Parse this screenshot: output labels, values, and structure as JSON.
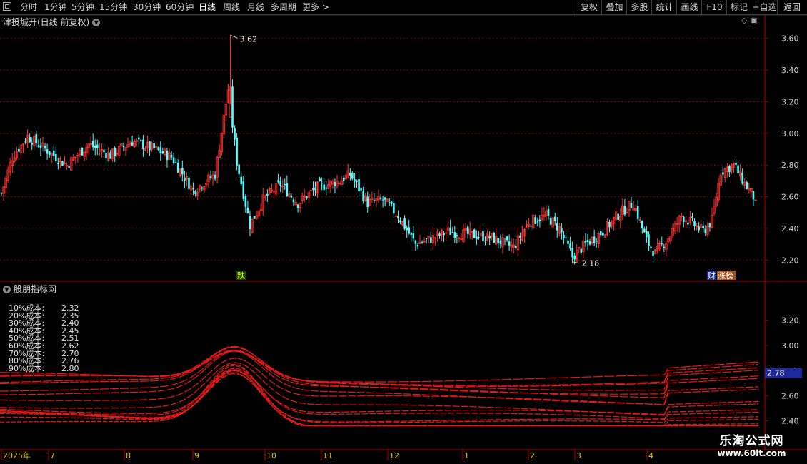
{
  "toolbar": {
    "periods": [
      "分时",
      "1分钟",
      "5分钟",
      "15分钟",
      "30分钟",
      "60分钟",
      "日线",
      "周线",
      "月线",
      "多周期",
      "更多"
    ],
    "active_period": "日线",
    "more_arrow": ">",
    "right_buttons": [
      "复权",
      "叠加",
      "多股",
      "统计",
      "画线",
      "F10",
      "标记",
      "+自选",
      "返回"
    ]
  },
  "stock_title": "津投城开(日线 前复权)",
  "indicator_title": "股朋指标网",
  "cost_table": [
    {
      "label": "10%成本:",
      "value": "2.32"
    },
    {
      "label": "20%成本:",
      "value": "2.35"
    },
    {
      "label": "30%成本:",
      "value": "2.40"
    },
    {
      "label": "40%成本:",
      "value": "2.45"
    },
    {
      "label": "50%成本:",
      "value": "2.51"
    },
    {
      "label": "60%成本:",
      "value": "2.62"
    },
    {
      "label": "70%成本:",
      "value": "2.70"
    },
    {
      "label": "80%成本:",
      "value": "2.76"
    },
    {
      "label": "90%成本:",
      "value": "2.80"
    }
  ],
  "watermark": {
    "line1": "乐淘公式网",
    "line2": "www.60lt.com"
  },
  "colors": {
    "up": "#ff3232",
    "down": "#54ffff",
    "grid": "#8b0000",
    "axis": "#d0d0d0",
    "chip": "#e81818"
  },
  "chart_data": [
    {
      "type": "candlestick",
      "title": "津投城开(日线 前复权)",
      "ylim": [
        2.12,
        3.68
      ],
      "y_ticks": [
        "3.60",
        "3.40",
        "3.20",
        "3.00",
        "2.80",
        "2.60",
        "2.40",
        "2.20"
      ],
      "grid": true,
      "x_ticks": [
        "2025年",
        "7",
        "8",
        "9",
        "10",
        "11",
        "12",
        "1",
        "2",
        "3",
        "4"
      ],
      "annotations": [
        {
          "text": "3.62",
          "kind": "high"
        },
        {
          "text": "2.18",
          "kind": "low"
        },
        {
          "text": "跌",
          "kind": "marker"
        },
        {
          "text": "财",
          "kind": "marker"
        },
        {
          "text": "涨榜",
          "kind": "marker"
        }
      ],
      "close_keypoints": [
        [
          0,
          2.62
        ],
        [
          5,
          2.85
        ],
        [
          12,
          2.98
        ],
        [
          20,
          2.9
        ],
        [
          30,
          2.8
        ],
        [
          40,
          2.93
        ],
        [
          50,
          2.86
        ],
        [
          60,
          2.95
        ],
        [
          70,
          2.9
        ],
        [
          78,
          2.85
        ],
        [
          88,
          2.64
        ],
        [
          98,
          2.74
        ],
        [
          104,
          3.28
        ],
        [
          108,
          2.82
        ],
        [
          114,
          2.42
        ],
        [
          120,
          2.58
        ],
        [
          128,
          2.68
        ],
        [
          136,
          2.56
        ],
        [
          145,
          2.66
        ],
        [
          155,
          2.7
        ],
        [
          160,
          2.74
        ],
        [
          168,
          2.56
        ],
        [
          175,
          2.58
        ],
        [
          182,
          2.48
        ],
        [
          190,
          2.3
        ],
        [
          198,
          2.34
        ],
        [
          205,
          2.38
        ],
        [
          215,
          2.36
        ],
        [
          225,
          2.34
        ],
        [
          235,
          2.28
        ],
        [
          242,
          2.44
        ],
        [
          250,
          2.48
        ],
        [
          256,
          2.4
        ],
        [
          262,
          2.22
        ],
        [
          268,
          2.3
        ],
        [
          276,
          2.38
        ],
        [
          284,
          2.5
        ],
        [
          290,
          2.56
        ],
        [
          296,
          2.32
        ],
        [
          300,
          2.24
        ],
        [
          306,
          2.34
        ],
        [
          312,
          2.48
        ],
        [
          318,
          2.42
        ],
        [
          322,
          2.38
        ],
        [
          326,
          2.45
        ],
        [
          330,
          2.76
        ],
        [
          336,
          2.8
        ],
        [
          342,
          2.66
        ],
        [
          346,
          2.58
        ]
      ],
      "last_close": 2.58
    },
    {
      "type": "chip_distribution",
      "title": "股朋指标网",
      "ylim": [
        2.34,
        3.42
      ],
      "y_ticks": [
        "3.20",
        "3.00",
        "2.80",
        "2.60",
        "2.40"
      ],
      "current_price_label": "2.78",
      "cost_levels": [
        2.32,
        2.35,
        2.4,
        2.45,
        2.51,
        2.62,
        2.7,
        2.76,
        2.8
      ]
    }
  ]
}
